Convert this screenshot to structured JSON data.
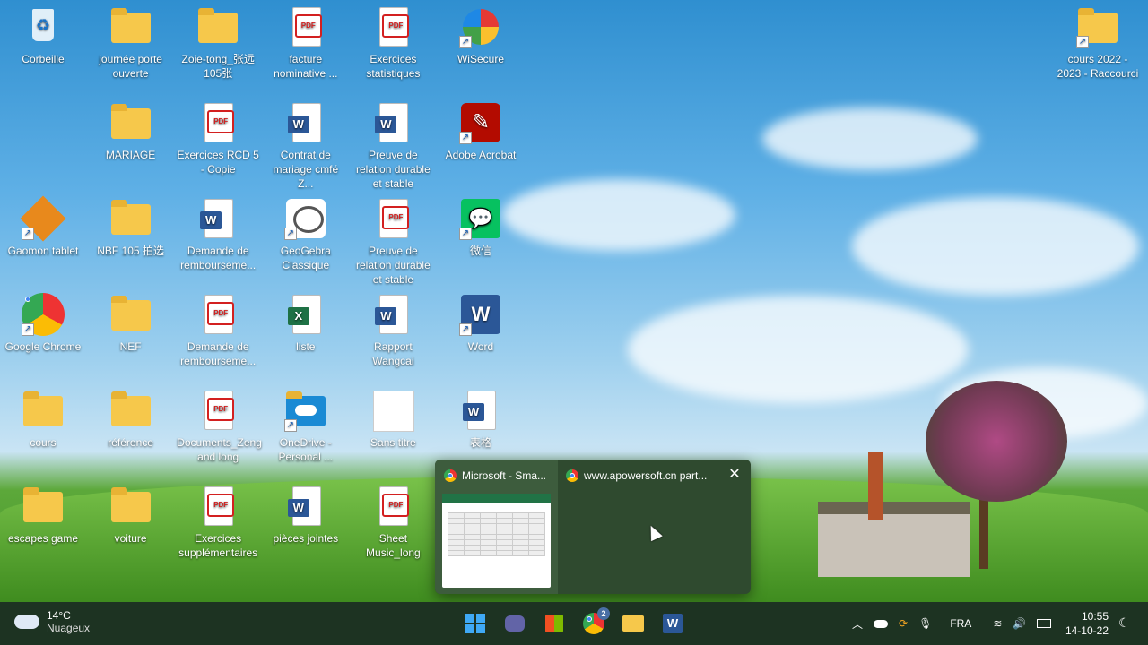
{
  "desktop": {
    "icons": [
      {
        "label": "Corbeille",
        "type": "recycle"
      },
      {
        "label": "journée porte ouverte",
        "type": "folder"
      },
      {
        "label": "Zoie-tong_张远 105张",
        "type": "folder"
      },
      {
        "label": "facture nominative ...",
        "type": "pdf"
      },
      {
        "label": "Exercices statistiques",
        "type": "pdf"
      },
      {
        "label": "WiSecure",
        "type": "wisecure"
      },
      {
        "label": "cours 2022 - 2023 - Raccourci",
        "type": "folder"
      },
      {
        "label": "MARIAGE",
        "type": "folder"
      },
      {
        "label": "Exercices RCD 5 - Copie",
        "type": "pdf"
      },
      {
        "label": "Contrat de mariage cmfé Z...",
        "type": "word-doc"
      },
      {
        "label": "Preuve de relation durable et stable",
        "type": "word-doc"
      },
      {
        "label": "Adobe Acrobat",
        "type": "acrobat"
      },
      {
        "label": "Gaomon tablet",
        "type": "gaomon"
      },
      {
        "label": "NBF 105 拍选",
        "type": "folder"
      },
      {
        "label": "Demande de rembourseme...",
        "type": "word-doc"
      },
      {
        "label": "GeoGebra Classique",
        "type": "geogebra"
      },
      {
        "label": "Preuve de relation durable et stable",
        "type": "pdf"
      },
      {
        "label": "微信",
        "type": "wechat"
      },
      {
        "label": "Google Chrome",
        "type": "chrome"
      },
      {
        "label": "NEF",
        "type": "folder"
      },
      {
        "label": "Demande de rembourseme...",
        "type": "pdf"
      },
      {
        "label": "liste",
        "type": "excel"
      },
      {
        "label": "Rapport Wangcai",
        "type": "word-doc"
      },
      {
        "label": "Word",
        "type": "word-app"
      },
      {
        "label": "cours",
        "type": "folder"
      },
      {
        "label": "référence",
        "type": "folder"
      },
      {
        "label": "Documents_Zeng and long",
        "type": "pdf"
      },
      {
        "label": "OneDrive - Personal ...",
        "type": "onedrive"
      },
      {
        "label": "Sans titre",
        "type": "blank"
      },
      {
        "label": "表格",
        "type": "word-doc"
      },
      {
        "label": "escapes game",
        "type": "folder"
      },
      {
        "label": "voiture",
        "type": "folder"
      },
      {
        "label": "Exercices supplémentaires",
        "type": "pdf"
      },
      {
        "label": "pièces jointes",
        "type": "word-doc"
      },
      {
        "label": "Sheet Music_long",
        "type": "pdf"
      }
    ]
  },
  "preview": {
    "tab1": "Microsoft - Sma...",
    "tab2": "www.apowersoft.cn part...",
    "close_icon": "close-icon"
  },
  "taskbar": {
    "weather_temp": "14°C",
    "weather_desc": "Nuageux",
    "chrome_badge": "2",
    "language": "FRA",
    "time": "10:55",
    "date": "14-10-22"
  }
}
